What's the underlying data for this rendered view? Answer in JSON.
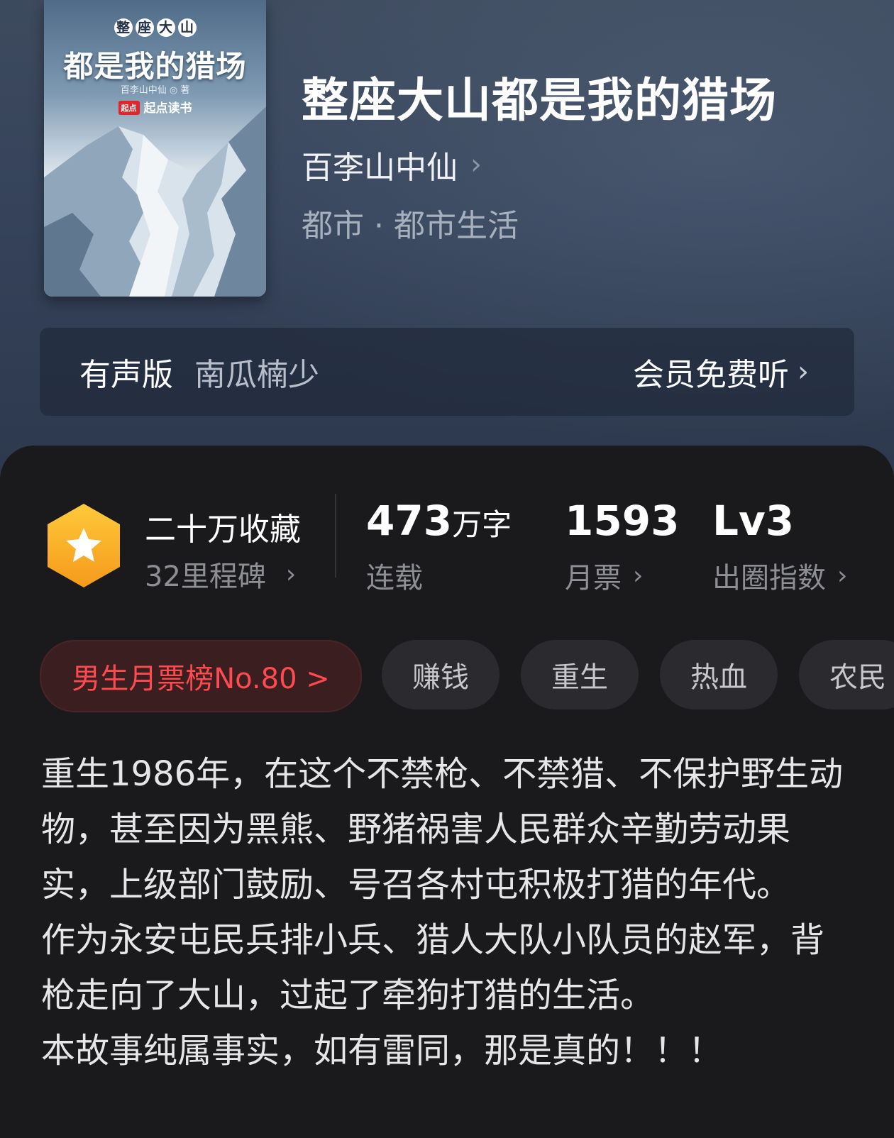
{
  "cover": {
    "series": [
      "整",
      "座",
      "大",
      "山"
    ],
    "title": "都是我的猎场",
    "author_line": "百李山中仙 ◎ 著",
    "publisher_badge": "起点",
    "publisher": "起点读书"
  },
  "book": {
    "title": "整座大山都是我的猎场",
    "author": "百李山中仙",
    "genre": "都市 · 都市生活"
  },
  "audio": {
    "label": "有声版",
    "narrator": "南瓜楠少",
    "action": "会员免费听"
  },
  "stats": {
    "favorites": "二十万收藏",
    "milestones": "32里程碑",
    "word_count": "473",
    "word_unit": "万字",
    "status": "连载",
    "monthly_votes": "1593",
    "monthly_votes_label": "月票",
    "level": "Lv3",
    "level_label": "出圈指数"
  },
  "tags": {
    "rank": "男生月票榜No.80 >",
    "items": [
      "赚钱",
      "重生",
      "热血",
      "农民"
    ]
  },
  "synopsis": [
    "重生1986年，在这个不禁枪、不禁猎、不保护野生动物，甚至因为黑熊、野猪祸害人民群众辛勤劳动果实，上级部门鼓励、号召各村屯积极打猎的年代。",
    "作为永安屯民兵排小兵、猎人大队小队员的赵军，背枪走向了大山，过起了牵狗打猎的生活。",
    "本故事纯属事实，如有雷同，那是真的！！！"
  ],
  "colors": {
    "accent_rank": "#ff4a4f",
    "hex_badge": "#f5a623"
  }
}
